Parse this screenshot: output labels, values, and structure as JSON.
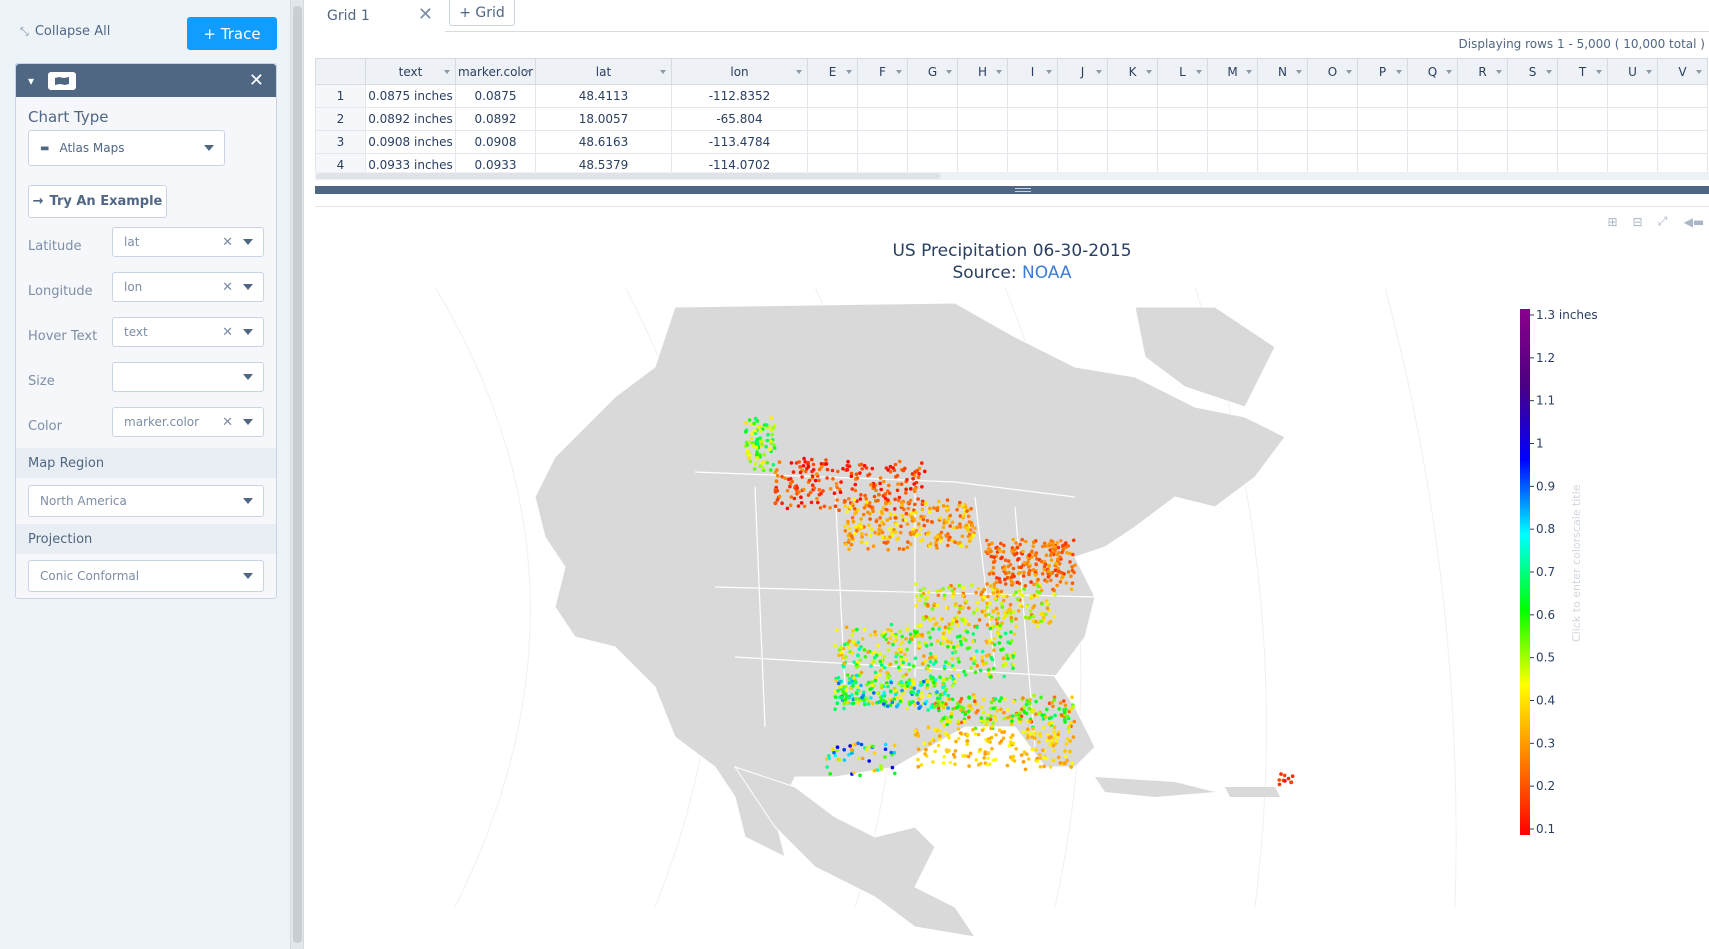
{
  "left_panel": {
    "collapse_all": "Collapse All",
    "trace_button": "+ Trace",
    "chart_type_title": "Chart Type",
    "chart_type_value": "Atlas Maps",
    "try_example": "Try An Example",
    "fields": [
      {
        "label": "Latitude",
        "value": "lat",
        "clearable": true
      },
      {
        "label": "Longitude",
        "value": "lon",
        "clearable": true
      },
      {
        "label": "Hover Text",
        "value": "text",
        "clearable": true
      },
      {
        "label": "Size",
        "value": "",
        "clearable": false
      },
      {
        "label": "Color",
        "value": "marker.color",
        "clearable": true
      }
    ],
    "map_region_title": "Map Region",
    "map_region_value": "North America",
    "projection_title": "Projection",
    "projection_value": "Conic Conformal"
  },
  "grid": {
    "tab_name": "Grid 1",
    "add_tab": "+ Grid",
    "rows_info": "Displaying rows 1 - 5,000 ( 10,000 total )",
    "columns": [
      "text",
      "marker.color",
      "lat",
      "lon",
      "E",
      "F",
      "G",
      "H",
      "I",
      "J",
      "K",
      "L",
      "M",
      "N",
      "O",
      "P",
      "Q",
      "R",
      "S",
      "T",
      "U",
      "V"
    ],
    "rows": [
      {
        "index": "1",
        "text": "0.0875 inches",
        "color": "0.0875",
        "lat": "48.4113",
        "lon": "-112.8352"
      },
      {
        "index": "2",
        "text": "0.0892 inches",
        "color": "0.0892",
        "lat": "18.0057",
        "lon": "-65.804"
      },
      {
        "index": "3",
        "text": "0.0908 inches",
        "color": "0.0908",
        "lat": "48.6163",
        "lon": "-113.4784"
      },
      {
        "index": "4",
        "text": "0.0933 inches",
        "color": "0.0933",
        "lat": "48.5379",
        "lon": "-114.0702"
      }
    ]
  },
  "plot": {
    "title_line1": "US Precipitation 06-30-2015",
    "title_source_prefix": "Source: ",
    "title_source_link": "NOAA",
    "colorbar_title_placeholder": "Click to enter colorscale title",
    "map_land_color": "#d9d9d9",
    "map_border_color": "#ffffff",
    "colorscale": [
      "#ff0000",
      "#ff7f00",
      "#ffff00",
      "#00ff00",
      "#00ffff",
      "#0000ff",
      "#4b0082",
      "#8b008b"
    ]
  },
  "chart_data": {
    "type": "scatter",
    "title": "US Precipitation 06-30-2015",
    "subtitle": "Source: NOAA",
    "map_region": "North America",
    "projection": "Conic Conformal",
    "total_points": 10000,
    "sample_points": [
      {
        "text": "0.0875 inches",
        "color": 0.0875,
        "lat": 48.4113,
        "lon": -112.8352
      },
      {
        "text": "0.0892 inches",
        "color": 0.0892,
        "lat": 18.0057,
        "lon": -65.804
      },
      {
        "text": "0.0908 inches",
        "color": 0.0908,
        "lat": 48.6163,
        "lon": -113.4784
      },
      {
        "text": "0.0933 inches",
        "color": 0.0933,
        "lat": 48.5379,
        "lon": -114.0702
      }
    ],
    "colorbar": {
      "ticks": [
        0.1,
        0.2,
        0.3,
        0.4,
        0.5,
        0.6,
        0.7,
        0.8,
        0.9,
        1,
        1.1,
        1.2,
        1.3
      ],
      "tick_labels": [
        "0.1",
        "0.2",
        "0.3",
        "0.4",
        "0.5",
        "0.6",
        "0.7",
        "0.8",
        "0.9",
        "1",
        "1.1",
        "1.2",
        "1.3 inches"
      ],
      "range": [
        0.1,
        1.3
      ]
    }
  }
}
